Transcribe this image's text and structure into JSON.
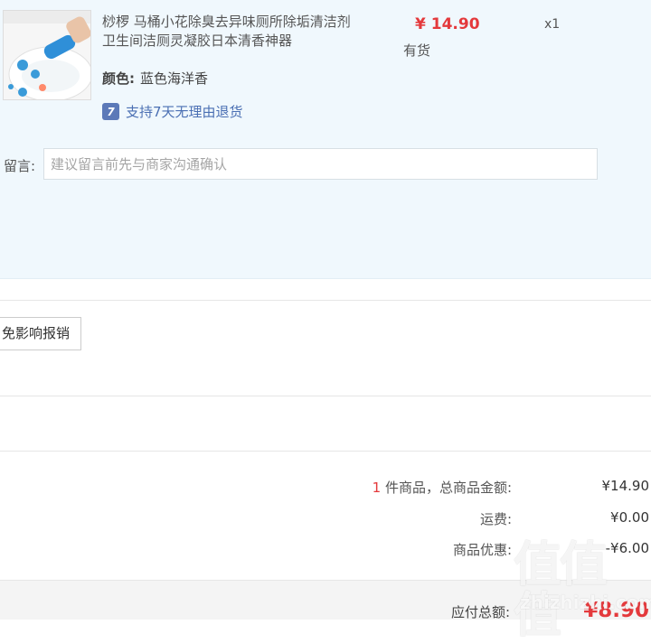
{
  "item": {
    "title": "桫椤 马桶小花除臭去异味厕所除垢清洁剂卫生间洁厕灵凝胶日本清香神器",
    "price": "¥ 14.90",
    "stock_status": "有货",
    "quantity": "x1",
    "color_label": "颜色:",
    "color_value": "蓝色海洋香",
    "return_badge": "7",
    "return_policy": "支持7天无理由退货"
  },
  "note": {
    "label": "留言:",
    "placeholder": "建议留言前先与商家沟通确认",
    "value": ""
  },
  "invoice": {
    "button_label": "免影响报销"
  },
  "summary": {
    "item_count": "1",
    "goods_total_label": "件商品，总商品金额:",
    "goods_total_value": "¥14.90",
    "shipping_label": "运费:",
    "shipping_value": "¥0.00",
    "discount_label": "商品优惠:",
    "discount_value": "-¥6.00",
    "payable_label": "应付总额:",
    "payable_value": "¥8.90"
  },
  "watermark": {
    "logo_text": "值值值",
    "url": "zhizhizhi.com"
  },
  "colors": {
    "price_red": "#e4393c",
    "panel_bg": "#f0f8fd",
    "link_blue": "#4a6fb3",
    "badge_blue": "#5c79b8"
  },
  "icons": {
    "return_badge": "seven-day-return-icon"
  }
}
